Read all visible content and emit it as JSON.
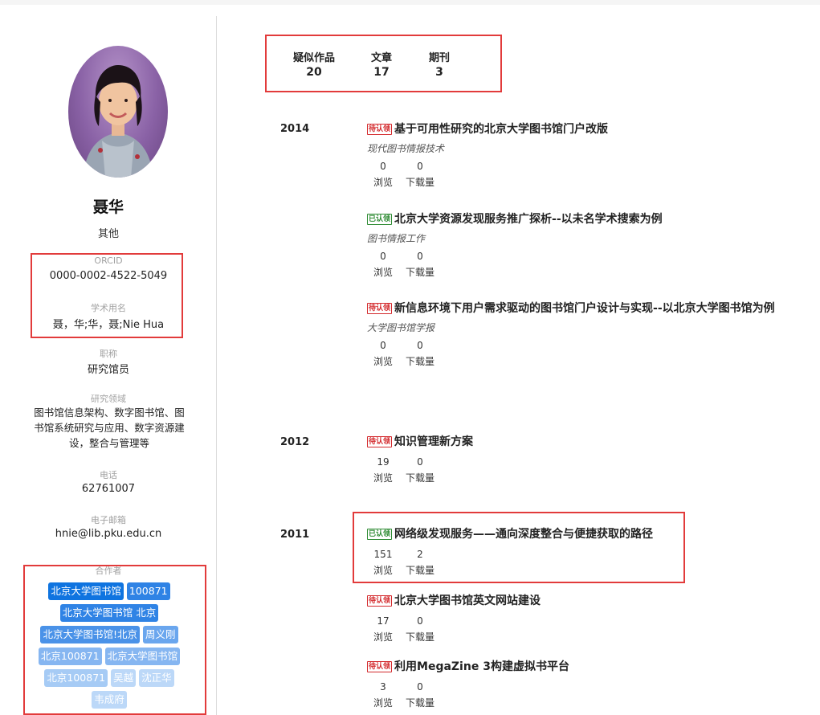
{
  "profile": {
    "name": "聂华",
    "role": "其他",
    "orcid_label": "ORCID",
    "orcid": "0000-0002-4522-5049",
    "alias_label": "学术用名",
    "alias": "聂，华;华，聂;Nie Hua",
    "title_label": "职称",
    "title": "研究馆员",
    "field_label": "研究领域",
    "field": "图书馆信息架构、数字图书馆、图书馆系统研究与应用、数字资源建设，整合与管理等",
    "phone_label": "电话",
    "phone": "62761007",
    "email_label": "电子邮箱",
    "email": "hnie@lib.pku.edu.cn",
    "coauthors_label": "合作者",
    "coauthors": [
      "北京大学图书馆",
      "100871",
      "北京大学图书馆 北京",
      "北京大学图书馆!北京",
      "周义刚",
      "北京100871",
      "北京大学图书馆",
      "北京100871",
      "吴越",
      "沈正华",
      "韦成府"
    ]
  },
  "stats": {
    "suspected_label": "疑似作品",
    "suspected": "20",
    "articles_label": "文章",
    "articles": "17",
    "journals_label": "期刊",
    "journals": "3"
  },
  "labels": {
    "views": "浏览",
    "downloads": "下载量"
  },
  "years": [
    "2014",
    "2012",
    "2011"
  ],
  "works": [
    {
      "badge": "待认领",
      "status": "pending",
      "title": "基于可用性研究的北京大学图书馆门户改版",
      "journal": "现代图书情报技术",
      "views": "0",
      "downloads": "0"
    },
    {
      "badge": "已认领",
      "status": "claimed",
      "title": "北京大学资源发现服务推广探析--以未名学术搜索为例",
      "journal": "图书情报工作",
      "views": "0",
      "downloads": "0"
    },
    {
      "badge": "待认领",
      "status": "pending",
      "title": "新信息环境下用户需求驱动的图书馆门户设计与实现--以北京大学图书馆为例",
      "journal": "大学图书馆学报",
      "views": "0",
      "downloads": "0"
    },
    {
      "badge": "待认领",
      "status": "pending",
      "title": "知识管理新方案",
      "journal": "",
      "views": "19",
      "downloads": "0"
    },
    {
      "badge": "已认领",
      "status": "claimed",
      "title": "网络级发现服务——通向深度整合与便捷获取的路径",
      "journal": "",
      "views": "151",
      "downloads": "2"
    },
    {
      "badge": "待认领",
      "status": "pending",
      "title": "北京大学图书馆英文网站建设",
      "journal": "",
      "views": "17",
      "downloads": "0"
    },
    {
      "badge": "待认领",
      "status": "pending",
      "title": "利用MegaZine 3构建虚拟书平台",
      "journal": "",
      "views": "3",
      "downloads": "0"
    }
  ],
  "colors": {
    "highlight_box": "#e23b3b",
    "pending": "#d3292c",
    "claimed": "#2e8b33",
    "tag_primary": "#0f74e0"
  }
}
